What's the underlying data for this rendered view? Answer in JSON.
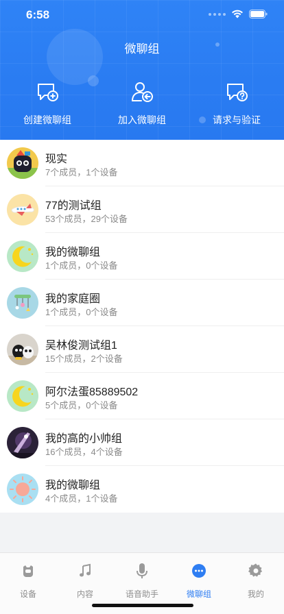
{
  "status": {
    "time": "6:58"
  },
  "header": {
    "title": "微聊组",
    "actions": [
      {
        "label": "创建微聊组",
        "icon": "chat-add-icon"
      },
      {
        "label": "加入微聊组",
        "icon": "user-join-icon"
      },
      {
        "label": "请求与验证",
        "icon": "chat-question-icon"
      }
    ]
  },
  "groups": [
    {
      "name": "现实",
      "meta": "7个成员，1个设备",
      "avatar": "robot-avatar"
    },
    {
      "name": "77的测试组",
      "meta": "53个成员，29个设备",
      "avatar": "plane-avatar"
    },
    {
      "name": "我的微聊组",
      "meta": "1个成员，0个设备",
      "avatar": "moon-avatar"
    },
    {
      "name": "我的家庭圈",
      "meta": "1个成员，0个设备",
      "avatar": "mobile-avatar"
    },
    {
      "name": "吴林俊测试组1",
      "meta": "15个成员，2个设备",
      "avatar": "photo-robot-avatar"
    },
    {
      "name": "阿尔法蛋85889502",
      "meta": "5个成员，0个设备",
      "avatar": "moon-avatar"
    },
    {
      "name": "我的高的小帅组",
      "meta": "16个成员，4个设备",
      "avatar": "photo-light-avatar"
    },
    {
      "name": "我的微聊组",
      "meta": "4个成员，1个设备",
      "avatar": "sun-avatar"
    }
  ],
  "tabs": [
    {
      "label": "设备",
      "icon": "device-icon",
      "active": false
    },
    {
      "label": "内容",
      "icon": "music-note-icon",
      "active": false
    },
    {
      "label": "语音助手",
      "icon": "microphone-icon",
      "active": false
    },
    {
      "label": "微聊组",
      "icon": "chat-bubble-icon",
      "active": true
    },
    {
      "label": "我的",
      "icon": "gear-icon",
      "active": false
    }
  ],
  "colors": {
    "accent": "#2f7ef2",
    "header": "#2f83f6",
    "inactive": "#8e8e8e"
  }
}
